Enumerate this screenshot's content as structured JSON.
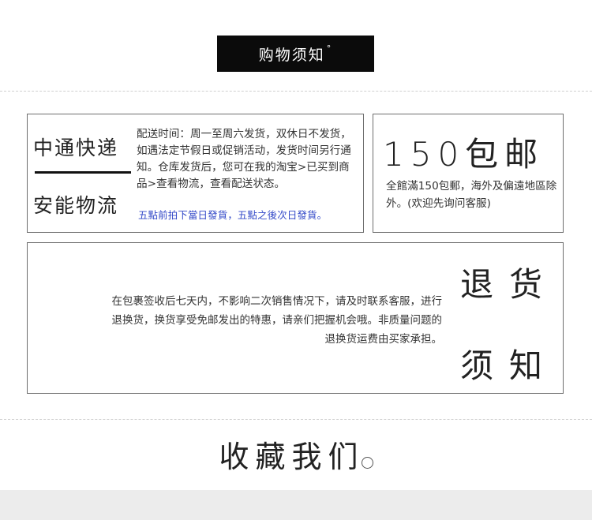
{
  "header": {
    "title": "购物须知",
    "degree_mark": "°"
  },
  "shipping": {
    "carrier_1": "中通快递",
    "carrier_2": "安能物流",
    "info": "配送时间：周一至周六发货，双休日不发货，如遇法定节假日或促销活动，发货时间另行通知。仓库发货后，您可在我的淘宝>已买到商品>查看物流，查看配送状态。",
    "note": "五點前拍下當日發貨，五點之後次日發貨。",
    "note_color": "#3349c8"
  },
  "free_shipping": {
    "title": "150包邮",
    "desc": "全館滿150包郵，海外及偏遠地區除外。(欢迎先询问客服)"
  },
  "returns": {
    "title_1": "退货",
    "title_2": "须知",
    "line_1": "在包裹签收后七天内，不影响二次销售情况下，请及时联系客服，进行",
    "line_2": "退换货，换货享受免邮发出的特惠，请亲们把握机会哦。非质量问题的",
    "line_3": "退换货运费由买家承担。"
  },
  "footer": {
    "title": "收藏我们"
  }
}
